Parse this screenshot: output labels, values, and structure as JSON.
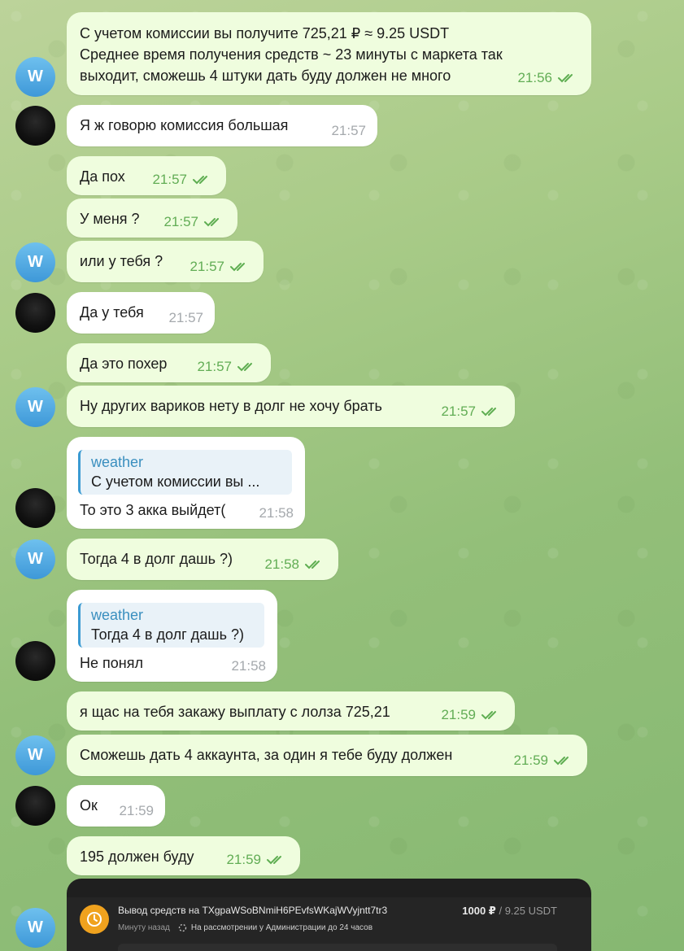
{
  "colors": {
    "outgoing_bubble": "#effdde",
    "incoming_bubble": "#ffffff",
    "outgoing_time": "#62ad55",
    "incoming_time": "#a5a9ad",
    "avatar_blue": "#3e98d8",
    "card_accent": "#f0a21e"
  },
  "avatar_letter": "W",
  "messages": [
    {
      "text": "С учетом комиссии вы получите 725,21 ₽ ≈ 9.25 USDT\nСреднее время получения средств ~ 23 минуты с маркета так\nвыходит, сможешь 4 штуки дать буду должен не много",
      "time": "21:56"
    },
    {
      "text": "Я ж говорю комиссия большая",
      "time": "21:57"
    },
    {
      "text": "Да пох",
      "time": "21:57"
    },
    {
      "text": "У меня ?",
      "time": "21:57"
    },
    {
      "text": "или у тебя ?",
      "time": "21:57"
    },
    {
      "text": "Да у тебя",
      "time": "21:57"
    },
    {
      "text": "Да это похер",
      "time": "21:57"
    },
    {
      "text": "Ну других вариков нету в долг не хочу брать",
      "time": "21:57"
    },
    {
      "reply_name": "weather",
      "reply_text": "С учетом комиссии вы ...",
      "text": "То это 3 акка выйдет(",
      "time": "21:58"
    },
    {
      "text": "Тогда 4 в долг дашь ?)",
      "time": "21:58"
    },
    {
      "reply_name": "weather",
      "reply_text": "Тогда 4 в долг дашь ?)",
      "text": "Не понял",
      "time": "21:58"
    },
    {
      "text": "я щас на тебя закажу выплату с лолза 725,21",
      "time": "21:59"
    },
    {
      "text": "Сможешь дать 4 аккаунта, за один я тебе буду должен",
      "time": "21:59"
    },
    {
      "text": "Ок",
      "time": "21:59"
    },
    {
      "text": "195 должен буду",
      "time": "21:59"
    }
  ],
  "withdraw_card": {
    "title": "Вывод средств на TXgpaWSoBNmiH6PEvfsWKajWVyjntt7tr3",
    "amount": "1000 ₽",
    "amount_usd": "/ 9.25 USDT",
    "time_ago": "Минуту назад",
    "status": "На рассмотрении у Администрации до 24 часов",
    "icon": "clock-icon"
  }
}
